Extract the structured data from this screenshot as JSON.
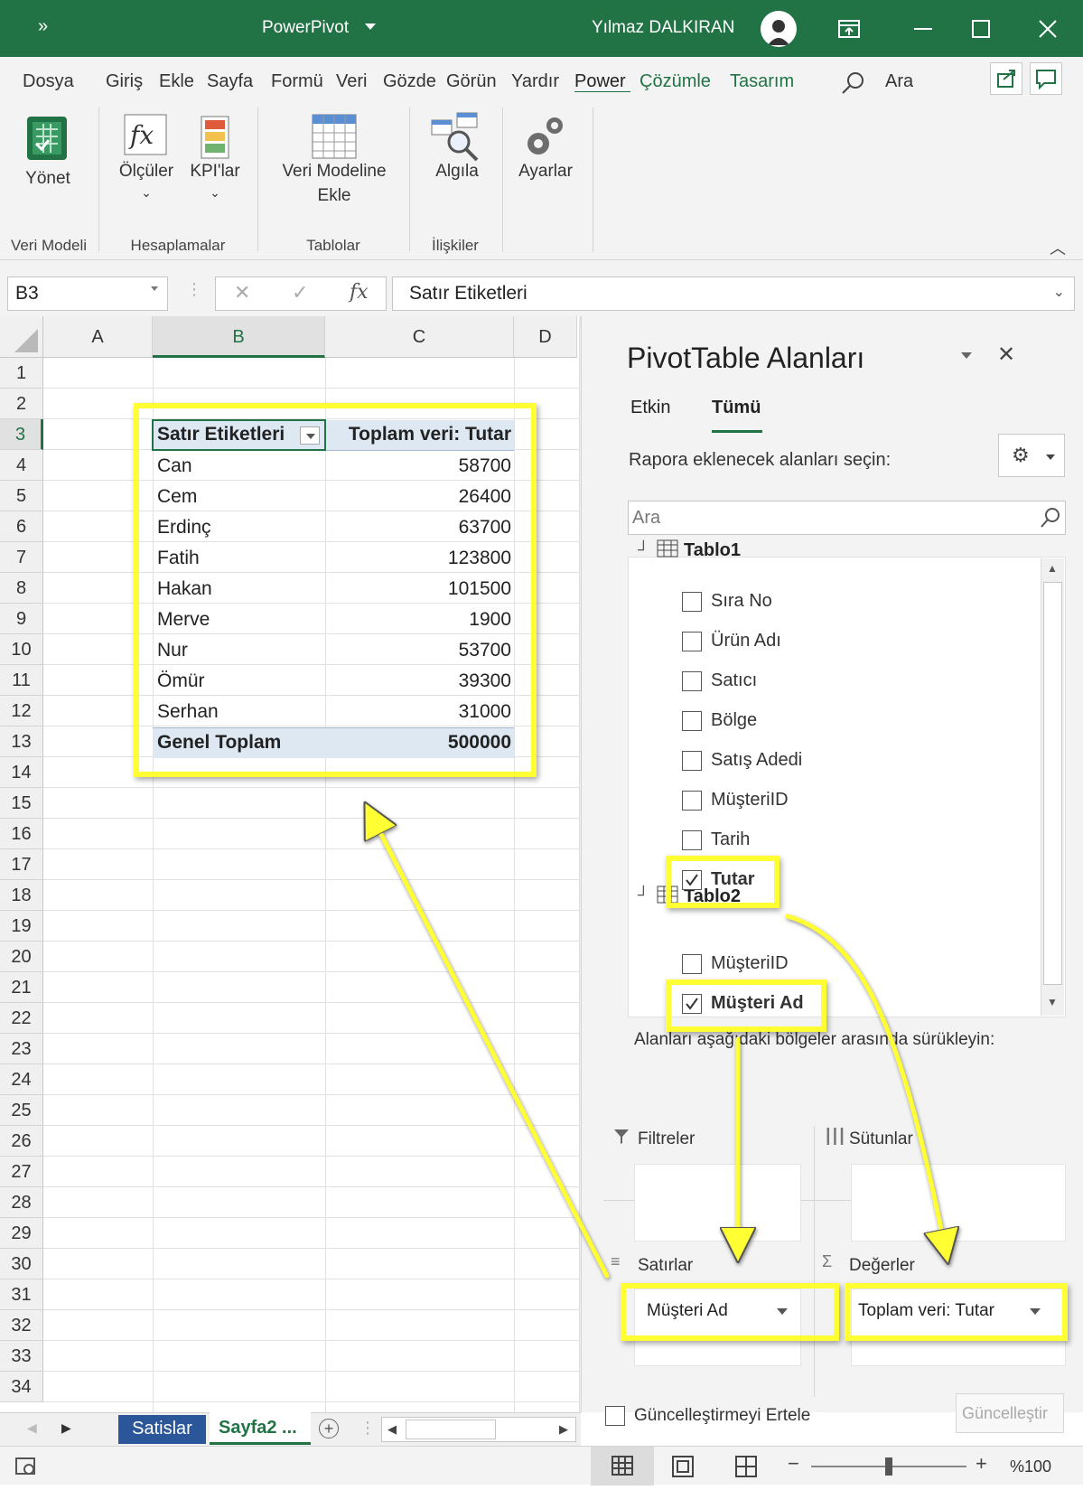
{
  "window": {
    "title": "PowerPivot",
    "user": "Yılmaz DALKIRAN",
    "quick_access": "»"
  },
  "ribbon_tabs": [
    "Dosya",
    "Giriş",
    "Ekle",
    "Sayfa",
    "Formü",
    "Veri",
    "Gözde",
    "Görün",
    "Yardır",
    "Power",
    "Çözümle",
    "Tasarım"
  ],
  "search_label": "Ara",
  "ribbon": {
    "manage": "Yönet",
    "measures": "Ölçüler",
    "kpis": "KPI'lar",
    "add_model_1": "Veri Modeline",
    "add_model_2": "Ekle",
    "detect": "Algıla",
    "settings": "Ayarlar",
    "groups": [
      "Veri Modeli",
      "Hesaplamalar",
      "Tablolar",
      "İlişkiler"
    ]
  },
  "formula_bar": {
    "name_box": "B3",
    "fx": "fx",
    "formula": "Satır Etiketleri"
  },
  "grid": {
    "columns": [
      "A",
      "B",
      "C",
      "D"
    ],
    "rows": [
      "1",
      "2",
      "3",
      "4",
      "5",
      "6",
      "7",
      "8",
      "9",
      "10",
      "11",
      "12",
      "13",
      "14",
      "15",
      "16",
      "17",
      "18",
      "19",
      "20",
      "21",
      "22",
      "23",
      "24",
      "25",
      "26",
      "27",
      "28",
      "29",
      "30",
      "31",
      "32",
      "33",
      "34"
    ]
  },
  "pivot": {
    "header_row_labels": "Satır Etiketleri",
    "header_values": "Toplam veri: Tutar",
    "rows": [
      {
        "name": "Can",
        "value": "58700"
      },
      {
        "name": "Cem",
        "value": "26400"
      },
      {
        "name": "Erdinç",
        "value": "63700"
      },
      {
        "name": "Fatih",
        "value": "123800"
      },
      {
        "name": "Hakan",
        "value": "101500"
      },
      {
        "name": "Merve",
        "value": "1900"
      },
      {
        "name": "Nur",
        "value": "53700"
      },
      {
        "name": "Ömür",
        "value": "39300"
      },
      {
        "name": "Serhan",
        "value": "31000"
      }
    ],
    "total_label": "Genel Toplam",
    "total_value": "500000"
  },
  "pane": {
    "title": "PivotTable Alanları",
    "tab_active": "Etkin",
    "tab_all": "Tümü",
    "choose_label": "Rapora eklenecek alanları seçin:",
    "search_placeholder": "Ara",
    "table1": "Tablo1",
    "table1_fields": [
      {
        "name": "Sıra No",
        "checked": false
      },
      {
        "name": "Ürün Adı",
        "checked": false
      },
      {
        "name": "Satıcı",
        "checked": false
      },
      {
        "name": "Bölge",
        "checked": false
      },
      {
        "name": "Satış Adedi",
        "checked": false
      },
      {
        "name": "MüşteriID",
        "checked": false
      },
      {
        "name": "Tarih",
        "checked": false
      },
      {
        "name": "Tutar",
        "checked": true
      }
    ],
    "table2": "Tablo2",
    "table2_fields": [
      {
        "name": "MüşteriID",
        "checked": false
      },
      {
        "name": "Müşteri Ad",
        "checked": true
      }
    ],
    "drag_label": "Alanları aşağıdaki bölgeler arasında sürükleyin:",
    "filters": "Filtreler",
    "columns": "Sütunlar",
    "rows": "Satırlar",
    "values": "Değerler",
    "rows_item": "Müşteri Ad",
    "values_item": "Toplam veri: Tutar",
    "defer": "Güncelleştirmeyi Ertele",
    "update": "Güncelleştir"
  },
  "sheets": {
    "sheet1": "Satislar",
    "sheet2": "Sayfa2 ..."
  },
  "status": {
    "zoom": "%100"
  },
  "colors": {
    "excel_green": "#217346",
    "highlight": "#ffff33",
    "pivot_header": "#dde8f3"
  }
}
